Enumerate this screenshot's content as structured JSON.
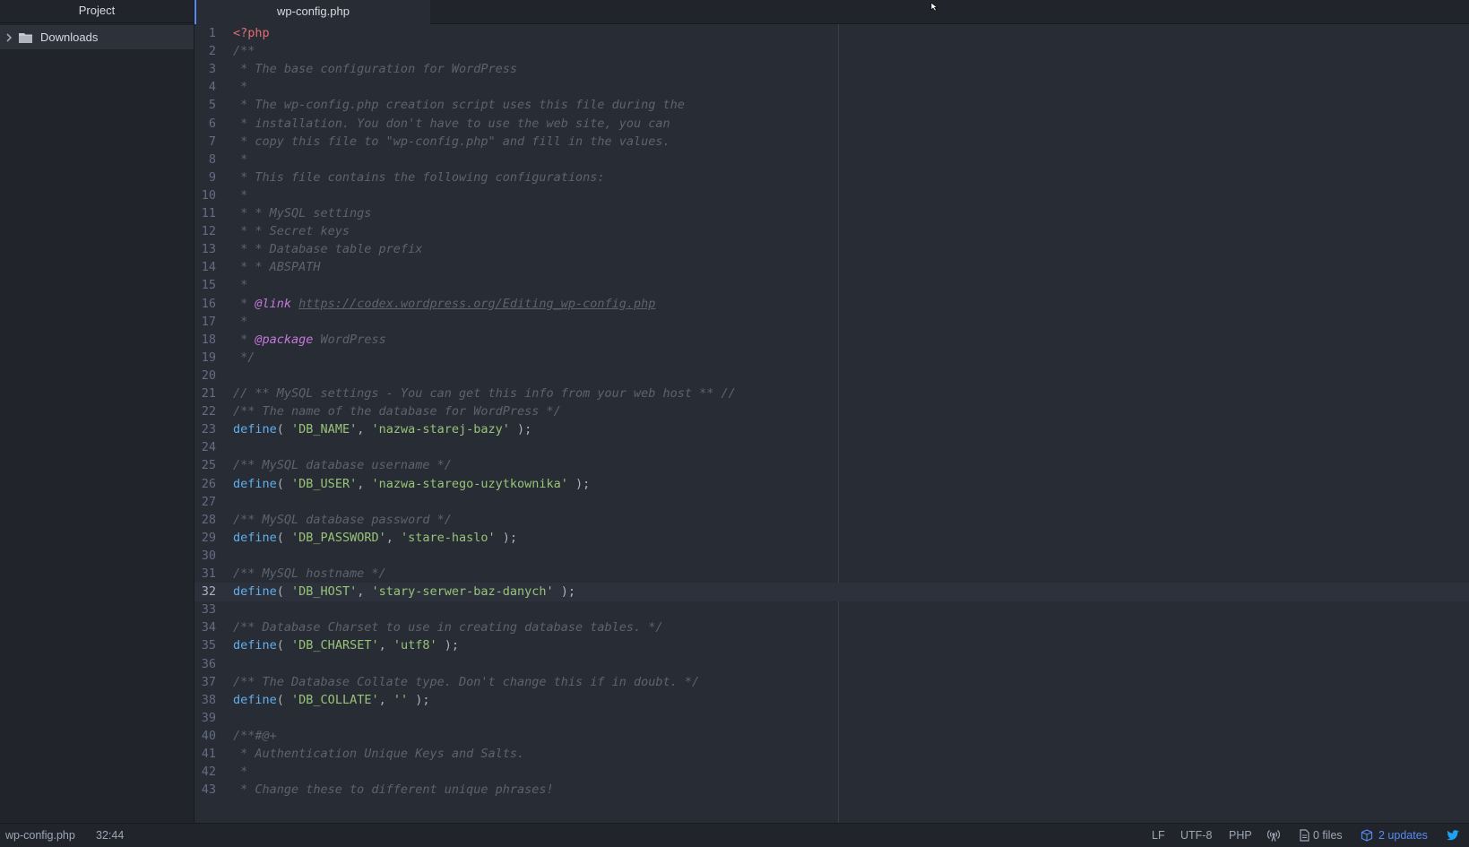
{
  "sidebar": {
    "header": "Project",
    "items": [
      {
        "label": "Downloads",
        "icon": "folder-icon",
        "expanded": false
      }
    ]
  },
  "tabs": [
    {
      "title": "wp-config.php",
      "active": true
    }
  ],
  "editor": {
    "current_line": 32,
    "lines": [
      {
        "n": "1",
        "t": [
          [
            "kw",
            "<?php"
          ]
        ]
      },
      {
        "n": "2",
        "t": [
          [
            "c",
            "/**"
          ]
        ]
      },
      {
        "n": "3",
        "t": [
          [
            "c",
            " * The base configuration for WordPress"
          ]
        ]
      },
      {
        "n": "4",
        "t": [
          [
            "c",
            " *"
          ]
        ]
      },
      {
        "n": "5",
        "t": [
          [
            "c",
            " * The wp-config.php creation script uses this file during the"
          ]
        ]
      },
      {
        "n": "6",
        "t": [
          [
            "c",
            " * installation. You don't have to use the web site, you can"
          ]
        ]
      },
      {
        "n": "7",
        "t": [
          [
            "c",
            " * copy this file to \"wp-config.php\" and fill in the values."
          ]
        ]
      },
      {
        "n": "8",
        "t": [
          [
            "c",
            " *"
          ]
        ]
      },
      {
        "n": "9",
        "t": [
          [
            "c",
            " * This file contains the following configurations:"
          ]
        ]
      },
      {
        "n": "10",
        "t": [
          [
            "c",
            " *"
          ]
        ]
      },
      {
        "n": "11",
        "t": [
          [
            "c",
            " * * MySQL settings"
          ]
        ]
      },
      {
        "n": "12",
        "t": [
          [
            "c",
            " * * Secret keys"
          ]
        ]
      },
      {
        "n": "13",
        "t": [
          [
            "c",
            " * * Database table prefix"
          ]
        ]
      },
      {
        "n": "14",
        "t": [
          [
            "c",
            " * * ABSPATH"
          ]
        ]
      },
      {
        "n": "15",
        "t": [
          [
            "c",
            " *"
          ]
        ]
      },
      {
        "n": "16",
        "t": [
          [
            "c",
            " * "
          ],
          [
            "tg",
            "@link"
          ],
          [
            "c",
            " "
          ],
          [
            "lk",
            "https://codex.wordpress.org/Editing_wp-config.php"
          ]
        ]
      },
      {
        "n": "17",
        "t": [
          [
            "c",
            " *"
          ]
        ]
      },
      {
        "n": "18",
        "t": [
          [
            "c",
            " * "
          ],
          [
            "tg",
            "@package"
          ],
          [
            "c",
            " WordPress"
          ]
        ]
      },
      {
        "n": "19",
        "t": [
          [
            "c",
            " */"
          ]
        ]
      },
      {
        "n": "20",
        "t": []
      },
      {
        "n": "21",
        "t": [
          [
            "c",
            "// ** MySQL settings - You can get this info from your web host ** //"
          ]
        ]
      },
      {
        "n": "22",
        "t": [
          [
            "c",
            "/** The name of the database for WordPress */"
          ]
        ]
      },
      {
        "n": "23",
        "t": [
          [
            "fn",
            "define"
          ],
          [
            "p",
            "( "
          ],
          [
            "st",
            "'DB_NAME'"
          ],
          [
            "p",
            ", "
          ],
          [
            "st",
            "'nazwa-starej-bazy'"
          ],
          [
            "p",
            " );"
          ]
        ]
      },
      {
        "n": "24",
        "t": []
      },
      {
        "n": "25",
        "t": [
          [
            "c",
            "/** MySQL database username */"
          ]
        ]
      },
      {
        "n": "26",
        "t": [
          [
            "fn",
            "define"
          ],
          [
            "p",
            "( "
          ],
          [
            "st",
            "'DB_USER'"
          ],
          [
            "p",
            ", "
          ],
          [
            "st",
            "'nazwa-starego-uzytkownika'"
          ],
          [
            "p",
            " );"
          ]
        ]
      },
      {
        "n": "27",
        "t": []
      },
      {
        "n": "28",
        "t": [
          [
            "c",
            "/** MySQL database password */"
          ]
        ]
      },
      {
        "n": "29",
        "t": [
          [
            "fn",
            "define"
          ],
          [
            "p",
            "( "
          ],
          [
            "st",
            "'DB_PASSWORD'"
          ],
          [
            "p",
            ", "
          ],
          [
            "st",
            "'stare-haslo'"
          ],
          [
            "p",
            " );"
          ]
        ]
      },
      {
        "n": "30",
        "t": []
      },
      {
        "n": "31",
        "t": [
          [
            "c",
            "/** MySQL hostname */"
          ]
        ]
      },
      {
        "n": "32",
        "t": [
          [
            "fn",
            "define"
          ],
          [
            "p",
            "( "
          ],
          [
            "st",
            "'DB_HOST'"
          ],
          [
            "p",
            ", "
          ],
          [
            "st",
            "'stary-serwer-baz-danych'"
          ],
          [
            "p",
            " );"
          ]
        ]
      },
      {
        "n": "33",
        "t": []
      },
      {
        "n": "34",
        "t": [
          [
            "c",
            "/** Database Charset to use in creating database tables. */"
          ]
        ]
      },
      {
        "n": "35",
        "t": [
          [
            "fn",
            "define"
          ],
          [
            "p",
            "( "
          ],
          [
            "st",
            "'DB_CHARSET'"
          ],
          [
            "p",
            ", "
          ],
          [
            "st",
            "'utf8'"
          ],
          [
            "p",
            " );"
          ]
        ]
      },
      {
        "n": "36",
        "t": []
      },
      {
        "n": "37",
        "t": [
          [
            "c",
            "/** The Database Collate type. Don't change this if in doubt. */"
          ]
        ]
      },
      {
        "n": "38",
        "t": [
          [
            "fn",
            "define"
          ],
          [
            "p",
            "( "
          ],
          [
            "st",
            "'DB_COLLATE'"
          ],
          [
            "p",
            ", "
          ],
          [
            "st",
            "''"
          ],
          [
            "p",
            " );"
          ]
        ]
      },
      {
        "n": "39",
        "t": []
      },
      {
        "n": "40",
        "t": [
          [
            "c",
            "/**#@+"
          ]
        ]
      },
      {
        "n": "41",
        "t": [
          [
            "c",
            " * Authentication Unique Keys and Salts."
          ]
        ]
      },
      {
        "n": "42",
        "t": [
          [
            "c",
            " *"
          ]
        ]
      },
      {
        "n": "43",
        "t": [
          [
            "c",
            " * Change these to different unique phrases!"
          ]
        ]
      }
    ]
  },
  "statusbar": {
    "file": "wp-config.php",
    "cursor": "32:44",
    "line_ending": "LF",
    "encoding": "UTF-8",
    "grammar": "PHP",
    "git_files": "0 files",
    "updates": "2 updates"
  },
  "colors": {
    "background": "#282c34",
    "sidebar": "#21252b",
    "comment": "#5c6370",
    "keyword": "#e06c75",
    "function": "#61afef",
    "string": "#98c379",
    "doc_tag": "#c678dd",
    "accent": "#568af2",
    "twitter": "#1da1f2"
  }
}
